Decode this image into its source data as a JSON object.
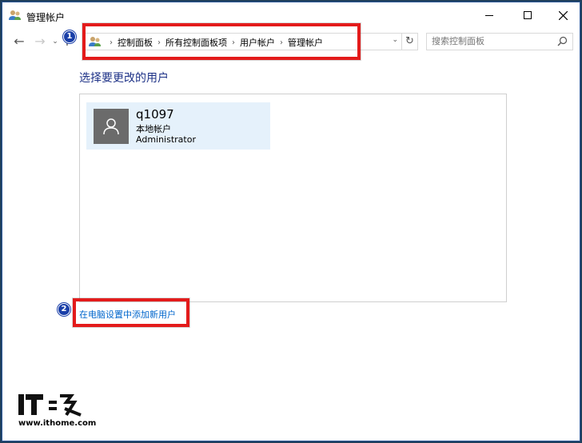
{
  "window": {
    "title": "管理帐户",
    "icon": "users-icon"
  },
  "nav": {
    "back_icon": "←",
    "forward_icon": "→",
    "recent_icon": "⌄",
    "up_icon": "↑",
    "breadcrumbs": [
      "控制面板",
      "所有控制面板项",
      "用户帐户",
      "管理帐户"
    ],
    "refresh_icon": "↻",
    "dropdown_icon": "⌄"
  },
  "search": {
    "placeholder": "搜索控制面板"
  },
  "content": {
    "heading": "选择要更改的用户",
    "user": {
      "name": "q1097",
      "type": "本地帐户",
      "role": "Administrator"
    },
    "add_user_link": "在电脑设置中添加新用户"
  },
  "annotations": {
    "badge1": "1",
    "badge2": "2",
    "highlight_color": "#e31b1b",
    "badge_color": "#1a3fa8"
  },
  "watermark": {
    "logo_text": "IT之家",
    "url": "www.ithome.com"
  },
  "colors": {
    "heading": "#1e3287",
    "link": "#0066cc",
    "tile_bg": "#e5f1fb",
    "avatar_bg": "#6b6b6b"
  }
}
